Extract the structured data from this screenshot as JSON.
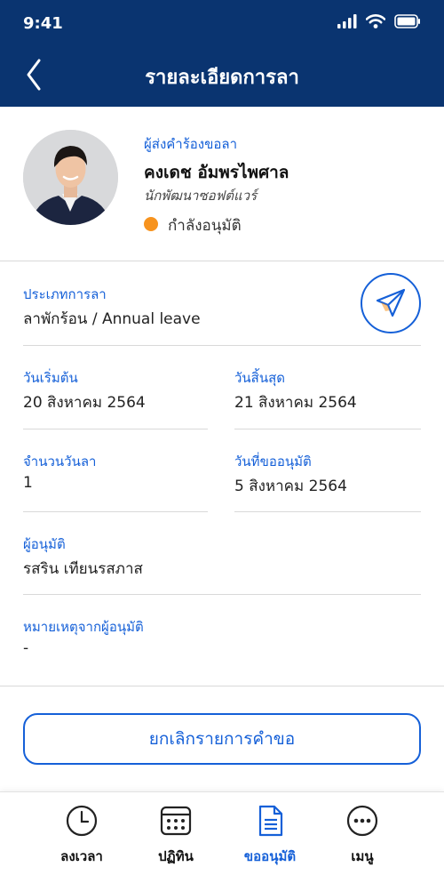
{
  "status_bar": {
    "time": "9:41"
  },
  "header": {
    "title": "รายละเอียดการลา"
  },
  "requester": {
    "label": "ผู้ส่งคำร้องขอลา",
    "name": "คงเดช อัมพรไพศาล",
    "role": "นักพัฒนาซอฟต์แวร์",
    "status": "กำลังอนุมัติ",
    "status_color": "#f7931e"
  },
  "details": {
    "leave_type": {
      "label": "ประเภทการลา",
      "value": "ลาพักร้อน / Annual leave"
    },
    "start_date": {
      "label": "วันเริ่มต้น",
      "value": "20 สิงหาคม 2564"
    },
    "end_date": {
      "label": "วันสิ้นสุด",
      "value": "21 สิงหาคม 2564"
    },
    "days": {
      "label": "จำนวนวันลา",
      "value": "1"
    },
    "request_date": {
      "label": "วันที่ขออนุมัติ",
      "value": "5 สิงหาคม 2564"
    },
    "approver": {
      "label": "ผู้อนุมัติ",
      "value": "รสริน เทียนรสภาส"
    },
    "approver_note": {
      "label": "หมายเหตุจากผู้อนุมัติ",
      "value": "-"
    }
  },
  "actions": {
    "cancel_label": "ยกเลิกรายการคำขอ"
  },
  "tabs": [
    {
      "label": "ลงเวลา",
      "icon": "clock-icon",
      "active": false
    },
    {
      "label": "ปฏิทิน",
      "icon": "calendar-icon",
      "active": false
    },
    {
      "label": "ขออนุมัติ",
      "icon": "document-icon",
      "active": true
    },
    {
      "label": "เมนู",
      "icon": "more-icon",
      "active": false
    }
  ],
  "colors": {
    "brand": "#0a3470",
    "accent": "#1560d8",
    "status_pending": "#f7931e"
  }
}
